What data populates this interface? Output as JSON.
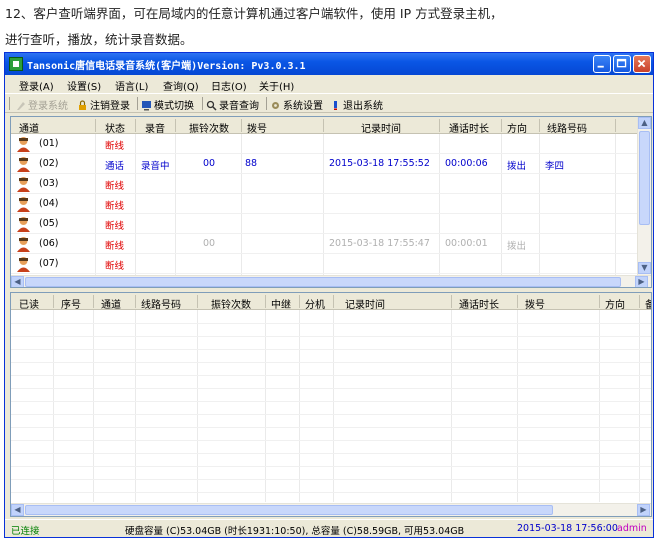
{
  "doc": {
    "line1": "12、客户查听端界面，可在局域内的任意计算机通过客户端软件，使用 IP 方式登录主机，",
    "line2": "进行查听，播放，统计录音数据。"
  },
  "window": {
    "title": "Tansonic唐信电话录音系统(客户端)Version: Pv3.0.3.1"
  },
  "menu": [
    "登录(A)",
    "设置(S)",
    "语言(L)",
    "查询(Q)",
    "日志(O)",
    "关于(H)"
  ],
  "toolbar": {
    "login": "登录系统",
    "logout": "注销登录",
    "mode": "模式切换",
    "query": "录音查询",
    "settings": "系统设置",
    "exit": "退出系统"
  },
  "top_grid": {
    "columns": [
      "通道",
      "状态",
      "录音",
      "振铃次数",
      "拨号",
      "记录时间",
      "通话时长",
      "方向",
      "线路号码"
    ],
    "rows": [
      {
        "channel": "(01)",
        "status": "断线",
        "record": "",
        "rings": "",
        "dial": "",
        "time": "",
        "duration": "",
        "direction": "",
        "line": "",
        "style": "normal"
      },
      {
        "channel": "(02)",
        "status": "通话",
        "record": "录音中",
        "rings": "00",
        "dial": "88",
        "time": "2015-03-18 17:55:52",
        "duration": "00:00:06",
        "direction": "拨出",
        "line": "李四",
        "style": "active"
      },
      {
        "channel": "(03)",
        "status": "断线",
        "record": "",
        "rings": "",
        "dial": "",
        "time": "",
        "duration": "",
        "direction": "",
        "line": "",
        "style": "normal"
      },
      {
        "channel": "(04)",
        "status": "断线",
        "record": "",
        "rings": "",
        "dial": "",
        "time": "",
        "duration": "",
        "direction": "",
        "line": "",
        "style": "normal"
      },
      {
        "channel": "(05)",
        "status": "断线",
        "record": "",
        "rings": "",
        "dial": "",
        "time": "",
        "duration": "",
        "direction": "",
        "line": "",
        "style": "normal"
      },
      {
        "channel": "(06)",
        "status": "断线",
        "record": "",
        "rings": "00",
        "dial": "",
        "time": "2015-03-18 17:55:47",
        "duration": "00:00:01",
        "direction": "拨出",
        "line": "",
        "style": "grey"
      },
      {
        "channel": "(07)",
        "status": "断线",
        "record": "",
        "rings": "",
        "dial": "",
        "time": "",
        "duration": "",
        "direction": "",
        "line": "",
        "style": "normal"
      }
    ]
  },
  "bottom_grid": {
    "columns": [
      "已读",
      "序号",
      "通道",
      "线路号码",
      "振铃次数",
      "中继",
      "分机",
      "记录时间",
      "通话时长",
      "拨号",
      "方向",
      "备"
    ]
  },
  "statusbar": {
    "connection": "已连接",
    "disk": "硬盘容量 (C)53.04GB (时长1931:10:50), 总容量 (C)58.59GB, 可用53.04GB",
    "datetime": "2015-03-18 17:56:00",
    "user": "admin"
  },
  "colors": {
    "titlebar": "#0a56e5",
    "disconnected": "#e00000",
    "active": "#0000cc",
    "connected": "#008000",
    "datetime": "#0000cc"
  }
}
